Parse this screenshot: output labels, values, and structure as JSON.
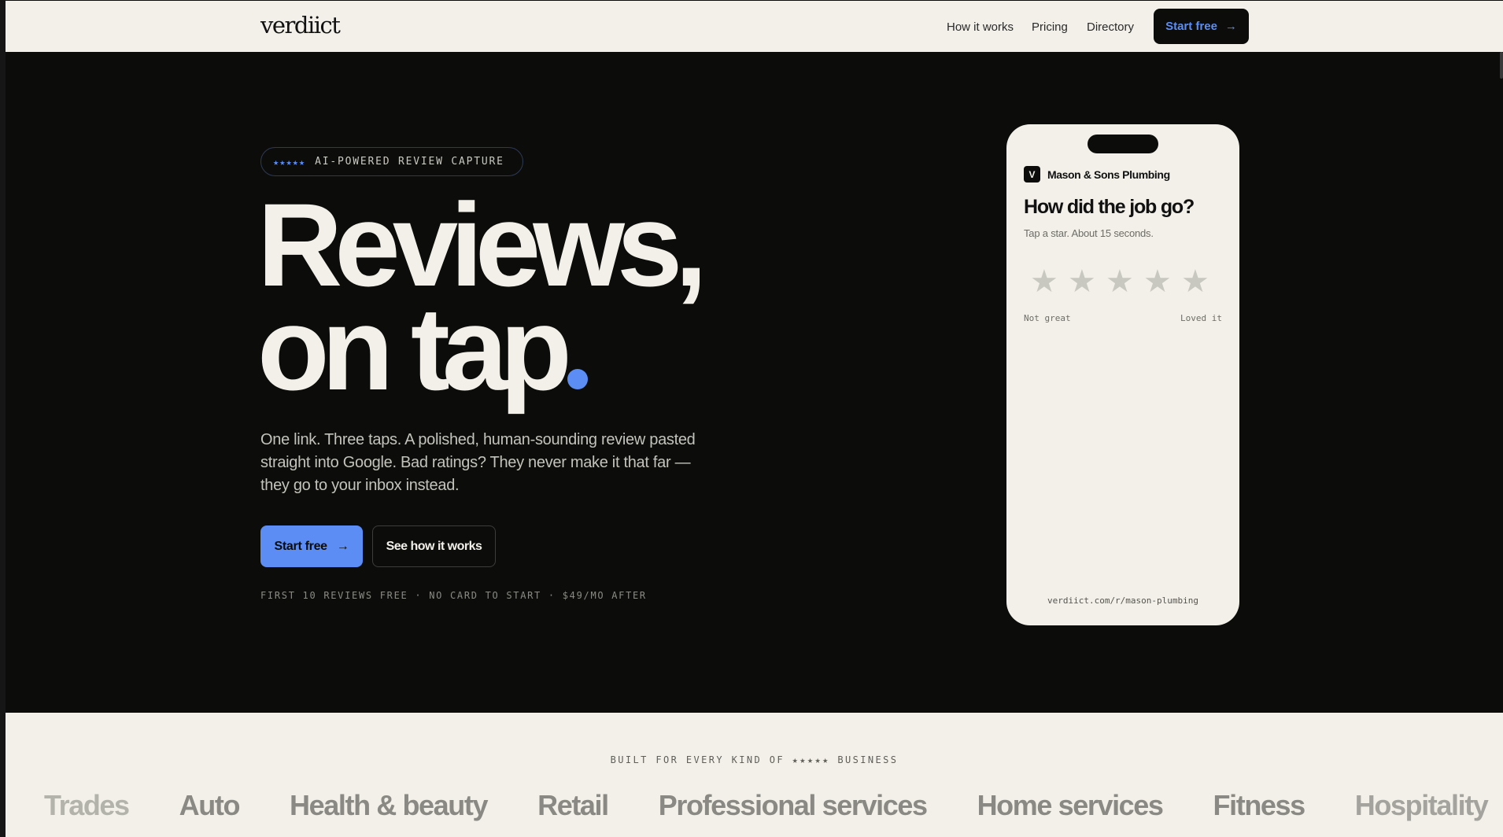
{
  "nav": {
    "logo": "verdiict",
    "links": [
      "How it works",
      "Pricing",
      "Directory"
    ],
    "cta_label": "Start free"
  },
  "hero": {
    "badge_stars": "★★★★★",
    "badge_text": "AI-POWERED REVIEW CAPTURE",
    "headline_line1": "Reviews,",
    "headline_line2": "on tap",
    "subtext": "One link. Three taps. A polished, human-sounding review pasted straight into Google. Bad ratings? They never make it that far — they go to your inbox instead.",
    "primary_cta": "Start free",
    "secondary_cta": "See how it works",
    "fineprint": "FIRST 10 REVIEWS FREE · NO CARD TO START · $49/MO AFTER"
  },
  "phone": {
    "business_initial": "V",
    "business_name": "Mason & Sons Plumbing",
    "question": "How did the job go?",
    "subtitle": "Tap a star. About 15 seconds.",
    "star_count": 5,
    "low_label": "Not great",
    "high_label": "Loved it",
    "url": "verdiict.com/r/mason-plumbing"
  },
  "industries": {
    "heading": "BUILT FOR EVERY KIND OF ★★★★★ BUSINESS",
    "items": [
      "Trades",
      "Auto",
      "Health & beauty",
      "Retail",
      "Professional services",
      "Home services",
      "Fitness",
      "Hospitality"
    ]
  },
  "colors": {
    "accent": "#5b8df5",
    "background_dark": "#0c0d0b",
    "background_light": "#f2f0e9"
  }
}
